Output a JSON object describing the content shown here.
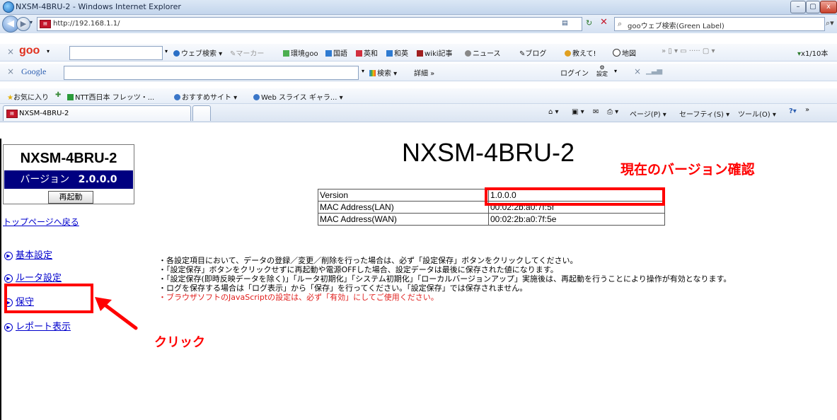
{
  "browser": {
    "window_title": "NXSM-4BRU-2 - Windows Internet Explorer",
    "address": "http://192.168.1.1/",
    "search_placeholder": "gooウェブ検索(Green Label)",
    "goo_toolbar": {
      "brand": "goo",
      "web_search": "ウェブ検索",
      "marker": "マーカー",
      "items": [
        "環境goo",
        "国語",
        "英和",
        "和英",
        "wiki記事",
        "ニュース",
        "ブログ",
        "教えて!",
        "地図"
      ],
      "counter": "x1/10本"
    },
    "google_toolbar": {
      "brand": "Google",
      "search": "検索",
      "detail": "詳細 »",
      "login": "ログイン",
      "settings": "設定"
    },
    "favorites_bar": {
      "favorites": "お気に入り",
      "items": [
        "NTT西日本 フレッツ・...",
        "おすすめサイト ▾",
        "Web スライス ギャラ... ▾"
      ]
    },
    "tab_title": "NXSM-4BRU-2",
    "command_bar": {
      "page": "ページ(P) ▾",
      "safety": "セーフティ(S) ▾",
      "tools": "ツール(O) ▾"
    }
  },
  "sidebar": {
    "device_name": "NXSM-4BRU-2",
    "version_label": "バージョン",
    "version_value": "2.0.0.0",
    "reboot_label": "再起動",
    "top_link": "トップページへ戻る",
    "menu": [
      {
        "label": "基本設定"
      },
      {
        "label": "ルータ設定"
      },
      {
        "label": "保守"
      },
      {
        "label": "レポート表示"
      }
    ]
  },
  "main": {
    "title": "NXSM-4BRU-2",
    "info_table": [
      {
        "key": "Version",
        "value": "1.0.0.0"
      },
      {
        "key": "MAC Address(LAN)",
        "value": "00:02:2b:a0:7f:5f"
      },
      {
        "key": "MAC Address(WAN)",
        "value": "00:02:2b:a0:7f:5e"
      }
    ],
    "notes": [
      "・各設定項目において、データの登録／変更／削除を行った場合は、必ず「設定保存」ボタンをクリックしてください。",
      "・「設定保存」ボタンをクリックせずに再起動や電源OFFした場合、設定データは最後に保存された値になります。",
      "・「設定保存(即時反映データを除く)」「ルータ初期化」「システム初期化」「ローカルバージョンアップ」実施後は、再起動を行うことにより操作が有効となります。",
      "・ログを保存する場合は「ログ表示」から「保存」を行ってください。「設定保存」では保存されません。"
    ],
    "warning_note": "・ブラウザソフトのJavaScriptの設定は、必ず「有効」にしてご使用ください。"
  },
  "annotations": {
    "version_check": "現在のバージョン確認",
    "click": "クリック"
  },
  "colors": {
    "annotation_red": "#ff0000",
    "version_band": "#000080",
    "link": "#0000cc"
  }
}
